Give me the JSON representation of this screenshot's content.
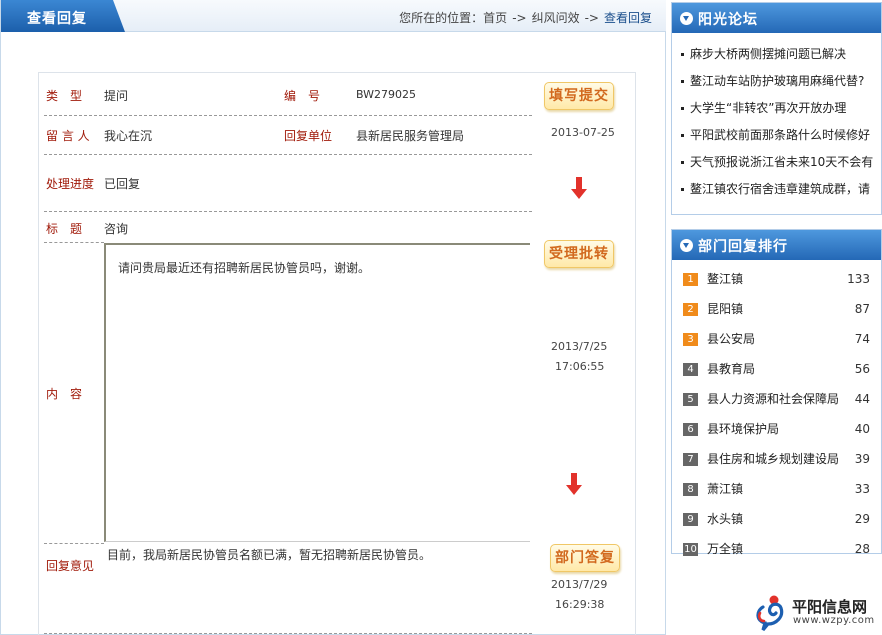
{
  "header": {
    "tab_title": "查看回复",
    "breadcrumb": {
      "prefix": "您所在的位置：",
      "home": "首页",
      "sep": "->",
      "section": "纠风问效",
      "current": "查看回复"
    }
  },
  "detail": {
    "type_label": "类　型",
    "type_value": "提问",
    "id_label": "编　号",
    "id_value": "BW279025",
    "author_label": "留 言 人",
    "author_value": "我心在沉",
    "unit_label": "回复单位",
    "unit_value": "县新居民服务管理局",
    "progress_label": "处理进度",
    "progress_value": "已回复",
    "subject_label": "标　题",
    "subject_value": "咨询",
    "content_label": "内　容",
    "content_value": "请问贵局最近还有招聘新居民协管员吗，谢谢。",
    "reply_label": "回复意见",
    "reply_value": "目前，我局新居民协管员名额已满，暂无招聘新居民协管员。"
  },
  "workflow": {
    "step1": {
      "label": "填写提交",
      "date": "2013-07-25"
    },
    "step2": {
      "label": "受理批转",
      "date": "2013/7/25",
      "time": "17:06:55"
    },
    "step3": {
      "label": "部门答复",
      "date": "2013/7/29",
      "time": "16:29:38"
    }
  },
  "forum": {
    "title": "阳光论坛",
    "items": [
      "麻步大桥两侧摆摊问题已解决",
      "鳌江动车站防护玻璃用麻绳代替?",
      "大学生“非转农”再次开放办理",
      "平阳武校前面那条路什么时候修好",
      "天气预报说浙江省未来10天不会有",
      "鳌江镇农行宿舍违章建筑成群，请"
    ]
  },
  "ranking": {
    "title": "部门回复排行",
    "items": [
      {
        "rank": "1",
        "name": "鳌江镇",
        "count": "133"
      },
      {
        "rank": "2",
        "name": "昆阳镇",
        "count": "87"
      },
      {
        "rank": "3",
        "name": "县公安局",
        "count": "74"
      },
      {
        "rank": "4",
        "name": "县教育局",
        "count": "56"
      },
      {
        "rank": "5",
        "name": "县人力资源和社会保障局",
        "count": "44"
      },
      {
        "rank": "6",
        "name": "县环境保护局",
        "count": "40"
      },
      {
        "rank": "7",
        "name": "县住房和城乡规划建设局",
        "count": "39"
      },
      {
        "rank": "8",
        "name": "萧江镇",
        "count": "33"
      },
      {
        "rank": "9",
        "name": "水头镇",
        "count": "29"
      },
      {
        "rank": "10",
        "name": "万全镇",
        "count": "28"
      }
    ]
  },
  "logo": {
    "name": "平阳信息网",
    "url": "www.wzpy.com"
  },
  "colors": {
    "accent_blue": "#2468b6",
    "label_red": "#a11b0b",
    "stamp_orange": "#d2691e",
    "arrow_red": "#e2322b",
    "rank_top": "#f08b1b",
    "rank_other": "#666666"
  }
}
